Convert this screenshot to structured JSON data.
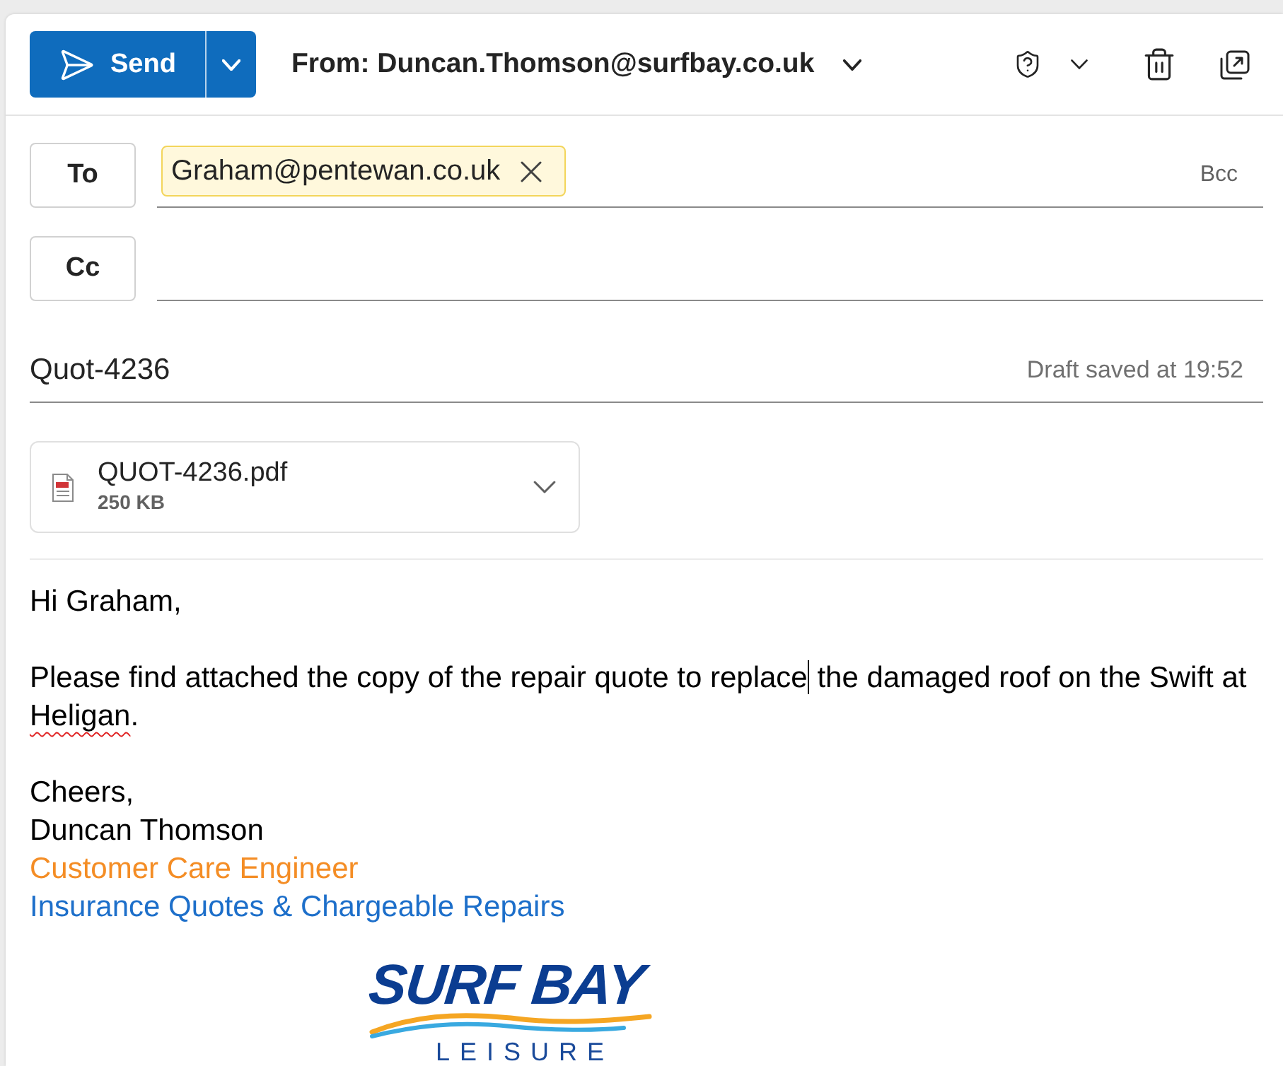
{
  "toolbar": {
    "send": {
      "label": "Send"
    },
    "from": "From: Duncan.Thomson@surfbay.co.uk"
  },
  "recipients": [
    {
      "label": "To",
      "chips": [
        {
          "text": "Graham@pentewan.co.uk"
        }
      ],
      "link": "Bcc"
    },
    {
      "label": "Cc"
    }
  ],
  "subject": {
    "value": "Quot-4236",
    "status": "Draft saved at 19:52"
  },
  "attachments": [
    {
      "name": "QUOT-4236.pdf",
      "size": "250 KB"
    }
  ],
  "body": {
    "greeting": "Hi Graham,",
    "paragraph": [
      {
        "kind": "text",
        "text": "Please find attached the copy of the repair quote to replace",
        "misspelled": false
      },
      {
        "kind": "cursor"
      },
      {
        "kind": "text",
        "text": " the damaged roof on the Swift at ",
        "misspelled": false
      },
      {
        "kind": "text",
        "text": "Heligan",
        "misspelled": true
      },
      {
        "kind": "text",
        "text": ".",
        "misspelled": false
      }
    ],
    "closing": "Cheers,",
    "signature": [
      {
        "text": "Duncan Thomson",
        "color": "#000000"
      },
      {
        "text": "Customer Care Engineer",
        "color": "#f48d25"
      },
      {
        "text": "Insurance Quotes & Chargeable Repairs",
        "color": "#1d6fca"
      }
    ]
  },
  "logo": {
    "name": "SURF BAY",
    "tagline": "LEISURE"
  }
}
